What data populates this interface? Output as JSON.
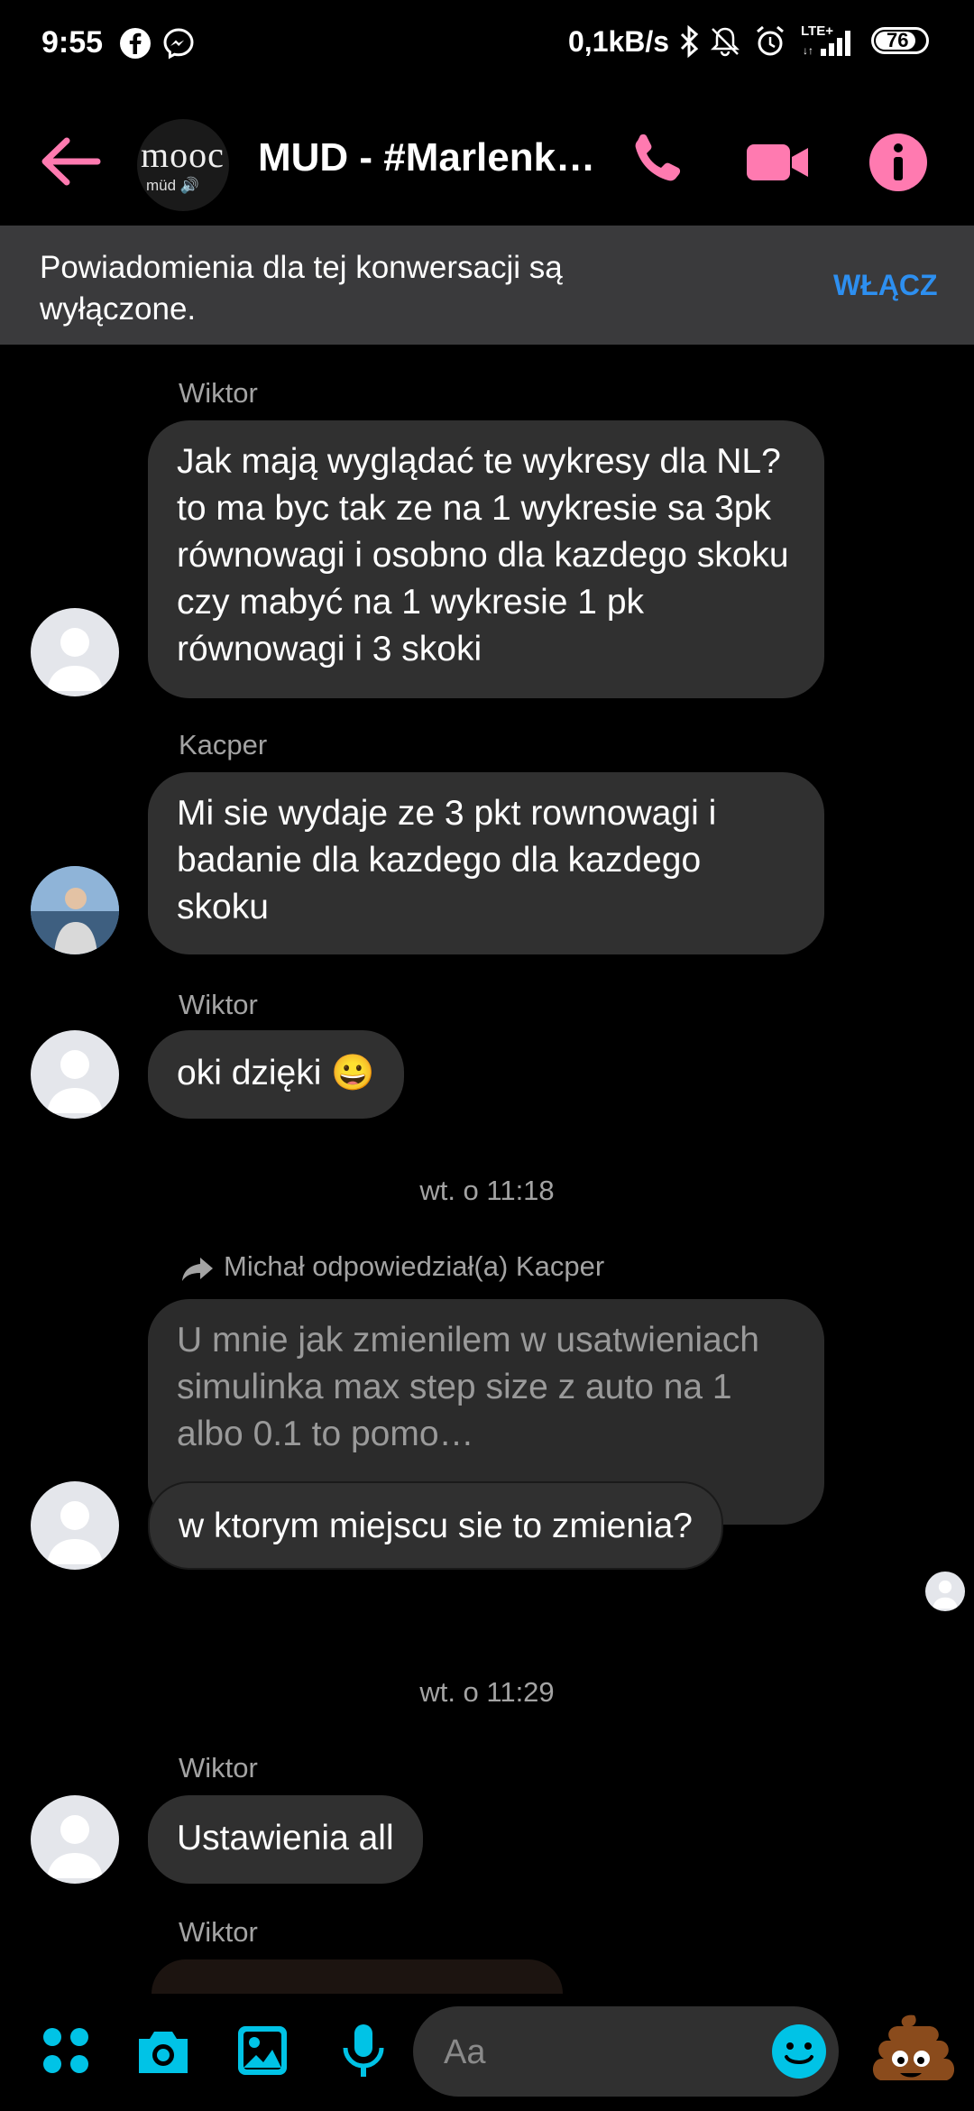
{
  "status_bar": {
    "time": "9:55",
    "net_speed": "0,1kB/s",
    "network_label": "LTE+",
    "battery": "76"
  },
  "header": {
    "group_avatar_text": "mooc",
    "group_avatar_sub": "müd 🔊",
    "title": "MUD - #Marlenka…",
    "accent_color": "#ff7ab0"
  },
  "notice": {
    "text": "Powiadomienia dla tej konwersacji są wyłączone.",
    "button": "WŁĄCZ"
  },
  "messages": [
    {
      "sender": "Wiktor",
      "text": "Jak mają wyglądać te wykresy dla NL? to ma byc tak ze na 1 wykresie sa 3pk równowagi i osobno dla kazdego skoku czy mabyć na 1 wykresie 1 pk równowagi i 3 skoki"
    },
    {
      "sender": "Kacper",
      "text": "Mi sie wydaje ze 3 pkt rownowagi i badanie dla kazdego dla kazdego skoku"
    },
    {
      "sender": "Wiktor",
      "text": "oki dzięki 😀"
    },
    {
      "timestamp": "wt. o 11:18"
    },
    {
      "reply_header": "Michał odpowiedział(a) Kacper",
      "quoted": "U mnie jak zmienilem w usatwieniach simulinka max step size z auto na 1 albo 0.1 to pomo…",
      "text": "w ktorym miejscu sie to zmienia?"
    },
    {
      "timestamp": "wt. o 11:29"
    },
    {
      "sender": "Wiktor",
      "text": "Ustawienia all"
    },
    {
      "sender": "Wiktor"
    }
  ],
  "composer": {
    "placeholder": "Aa",
    "icon_color": "#00c3e6"
  }
}
